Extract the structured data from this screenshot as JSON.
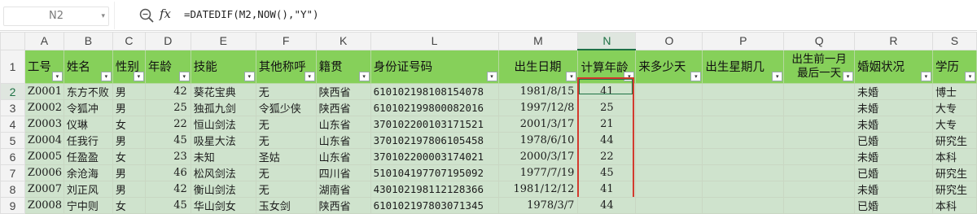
{
  "formula_bar": {
    "name_box": "N2",
    "fx_label": "fx",
    "formula": "=DATEDIF(M2,NOW(),\"Y\")"
  },
  "columns": [
    "A",
    "B",
    "C",
    "D",
    "F",
    "K",
    "L",
    "M",
    "N",
    "O",
    "P",
    "Q",
    "R",
    "S"
  ],
  "selected_column": "N",
  "headers": [
    "工号",
    "姓名",
    "性别",
    "年龄",
    "技能",
    "其他称呼",
    "籍贯",
    "身份证号码",
    "出生日期",
    "计算年龄",
    "来多少天",
    "出生星期几",
    "出生前一月最后一天",
    "婚姻状况",
    "学历"
  ],
  "header_two_line": [
    "出生前一月",
    "最后一天"
  ],
  "row_numbers": [
    "1",
    "2",
    "3",
    "4",
    "5",
    "6",
    "7",
    "8",
    "9"
  ],
  "rows": [
    {
      "id": "Z0001",
      "name": "东方不败",
      "gender": "男",
      "age": "42",
      "skill": "葵花宝典",
      "alias": "无",
      "origin": "陕西省",
      "idno": "610102198108154078",
      "birth": "1981/8/15",
      "calc": "41",
      "days": "",
      "weekday": "",
      "lastday": "",
      "marital": "未婚",
      "edu": "博士"
    },
    {
      "id": "Z0002",
      "name": "令狐冲",
      "gender": "男",
      "age": "25",
      "skill": "独孤九剑",
      "alias": "令狐少侠",
      "origin": "陕西省",
      "idno": "610102199800082016",
      "birth": "1997/12/8",
      "calc": "25",
      "days": "",
      "weekday": "",
      "lastday": "",
      "marital": "未婚",
      "edu": "大专"
    },
    {
      "id": "Z0003",
      "name": "仪琳",
      "gender": "女",
      "age": "22",
      "skill": "恒山剑法",
      "alias": "无",
      "origin": "山东省",
      "idno": "370102200103171521",
      "birth": "2001/3/17",
      "calc": "21",
      "days": "",
      "weekday": "",
      "lastday": "",
      "marital": "未婚",
      "edu": "大专"
    },
    {
      "id": "Z0004",
      "name": "任我行",
      "gender": "男",
      "age": "45",
      "skill": "吸星大法",
      "alias": "无",
      "origin": "山东省",
      "idno": "370102197806105458",
      "birth": "1978/6/10",
      "calc": "44",
      "days": "",
      "weekday": "",
      "lastday": "",
      "marital": "已婚",
      "edu": "研究生"
    },
    {
      "id": "Z0005",
      "name": "任盈盈",
      "gender": "女",
      "age": "23",
      "skill": "未知",
      "alias": "圣姑",
      "origin": "山东省",
      "idno": "370102200003174021",
      "birth": "2000/3/17",
      "calc": "22",
      "days": "",
      "weekday": "",
      "lastday": "",
      "marital": "未婚",
      "edu": "本科"
    },
    {
      "id": "Z0006",
      "name": "余沧海",
      "gender": "男",
      "age": "46",
      "skill": "松风剑法",
      "alias": "无",
      "origin": "四川省",
      "idno": "510104197707195092",
      "birth": "1977/7/19",
      "calc": "45",
      "days": "",
      "weekday": "",
      "lastday": "",
      "marital": "已婚",
      "edu": "研究生"
    },
    {
      "id": "Z0007",
      "name": "刘正风",
      "gender": "男",
      "age": "42",
      "skill": "衡山剑法",
      "alias": "无",
      "origin": "湖南省",
      "idno": "430102198112128366",
      "birth": "1981/12/12",
      "calc": "41",
      "days": "",
      "weekday": "",
      "lastday": "",
      "marital": "未婚",
      "edu": "研究生"
    },
    {
      "id": "Z0008",
      "name": "宁中则",
      "gender": "女",
      "age": "45",
      "skill": "华山剑女",
      "alias": "玉女剑",
      "origin": "陕西省",
      "idno": "610102197803071345",
      "birth": "1978/3/7",
      "calc": "44",
      "days": "",
      "weekday": "",
      "lastday": "",
      "marital": "已婚",
      "edu": "本科"
    }
  ]
}
